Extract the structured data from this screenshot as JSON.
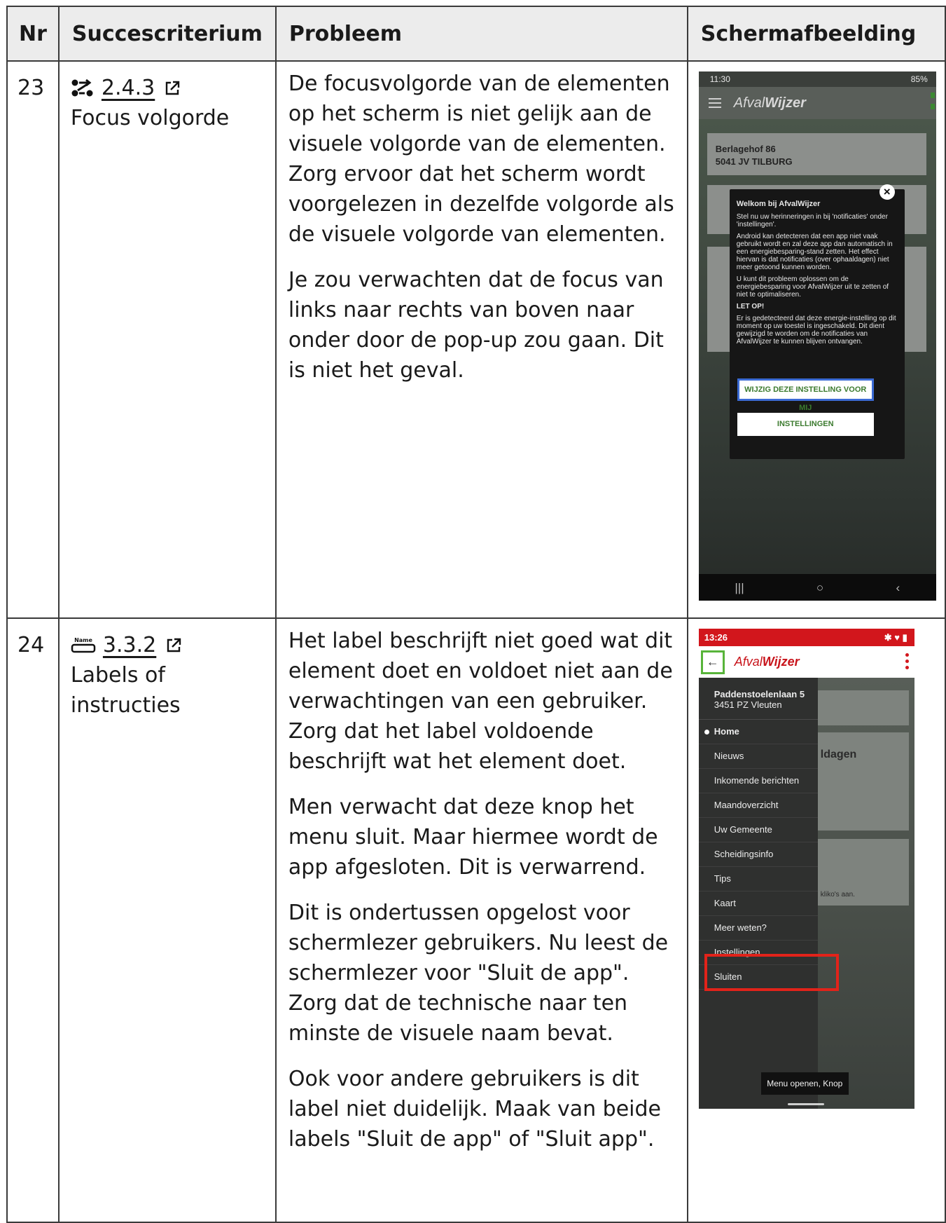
{
  "table": {
    "headers": {
      "nr": "Nr",
      "criterion": "Succescriterium",
      "problem": "Probleem",
      "screenshot": "Schermafbeelding"
    },
    "rows": [
      {
        "nr": "23",
        "criterion_code": "2.4.3",
        "criterion_name": "Focus volgorde",
        "icon": "focus-order-icon",
        "problem": [
          "De focusvolgorde van de elementen op het scherm is niet gelijk aan de visuele volgorde van de elementen. Zorg ervoor dat het scherm wordt voorgelezen in dezelfde volgorde als de visuele volgorde van elementen.",
          "Je zou verwachten dat de focus van links naar rechts van boven naar onder door de pop-up zou gaan. Dit is niet het geval."
        ]
      },
      {
        "nr": "24",
        "criterion_code": "3.3.2",
        "criterion_name": "Labels of instructies",
        "icon": "name-label-icon",
        "problem": [
          "Het label beschrijft niet goed wat dit element doet en voldoet niet aan de verwachtingen van een gebruiker. Zorg dat het label voldoende beschrijft wat het element doet.",
          "Men verwacht dat deze knop het menu sluit. Maar hiermee wordt de app afgesloten. Dit is verwarrend.",
          "Dit is ondertussen opgelost voor schermlezer gebruikers. Nu leest de schermlezer voor \"Sluit de app\". Zorg dat de technische naar ten minste de visuele naam bevat.",
          "Ook voor andere gebruikers is dit label niet duidelijk. Maak van beide labels \"Sluit de app\" of \"Sluit app\"."
        ]
      }
    ]
  },
  "name_icon_text": "Name",
  "phone1": {
    "time": "11:30",
    "battery": "85%",
    "logo_light": "Afval",
    "logo_bold": "Wijzer",
    "address_line1": "Berlagehof 86",
    "address_line2": "5041 JV TILBURG",
    "dialog_title": "Welkom bij AfvalWijzer",
    "dialog_p1": "Stel nu uw herinneringen in bij 'notificaties' onder 'instellingen'.",
    "dialog_p2": "Android kan detecteren dat een app niet vaak gebruikt wordt en zal deze app dan automatisch in een energiebesparing-stand zetten. Het effect hiervan is dat notificaties (over ophaaldagen) niet meer getoond kunnen worden.",
    "dialog_p3": "U kunt dit probleem oplossen om de energiebesparing voor AfvalWijzer uit te zetten of niet te optimaliseren.",
    "dialog_warning": "LET OP!",
    "dialog_p4": "Er is gedetecteerd dat deze energie-instelling op dit moment op uw toestel is ingeschakeld. Dit dient gewijzigd te worden om de notificaties van AfvalWijzer te kunnen blijven ontvangen.",
    "button_primary": "WIJZIG DEZE INSTELLING VOOR MIJ",
    "button_secondary": "INSTELLINGEN"
  },
  "phone2": {
    "time": "13:26",
    "logo_light": "Afval",
    "logo_bold": "Wijzer",
    "address_line1": "Paddenstoelenlaan 5",
    "address_line2": "3451 PZ Vleuten",
    "menu": [
      "Home",
      "Nieuws",
      "Inkomende berichten",
      "Maandoverzicht",
      "Uw Gemeente",
      "Scheidingsinfo",
      "Tips",
      "Kaart",
      "Meer weten?",
      "Instellingen",
      "Sluiten"
    ],
    "card_fragment_1": "ldagen",
    "card_fragment_2": "kliko's aan.",
    "toast": "Menu openen, Knop"
  },
  "colors": {
    "brand_red": "#d2161c",
    "highlight_red": "#e2231a",
    "focus_green": "#58b43a",
    "focus_blue": "#3b6bd4"
  }
}
